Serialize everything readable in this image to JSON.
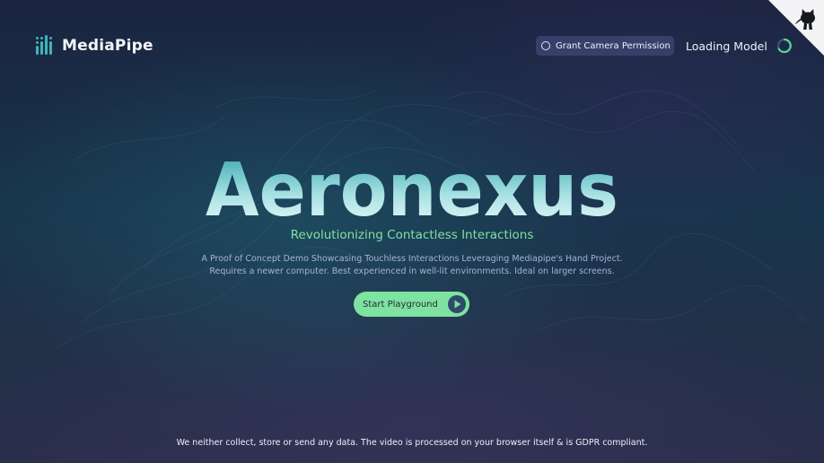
{
  "header": {
    "brand_name": "MediaPipe",
    "permission_button_label": "Grant Camera Permission",
    "loading_label": "Loading Model"
  },
  "hero": {
    "title": "Aeronexus",
    "tagline": "Revolutionizing Contactless Interactions",
    "description_line1": "A Proof of Concept Demo Showcasing Touchless Interactions Leveraging Mediapipe's Hand Project.",
    "description_line2": "Requires a newer computer. Best experienced in well-lit environments. Ideal on larger screens.",
    "cta_label": "Start Playground"
  },
  "footer": {
    "privacy_note": "We neither collect, store or send any data. The video is processed on your browser itself & is GDPR compliant."
  },
  "icons": {
    "brand": "mediapipe-logo-icon",
    "permission": "ring-icon",
    "loading": "spinner-icon",
    "cta": "play-icon",
    "corner": "github-octocat-icon"
  },
  "colors": {
    "accent_green": "#7ee2a0",
    "brand_teal": "#3fb5b8",
    "button_bg": "#37406a",
    "title_fill_top": "#2fa2a8",
    "title_fill_bottom": "#f2fbfb"
  }
}
